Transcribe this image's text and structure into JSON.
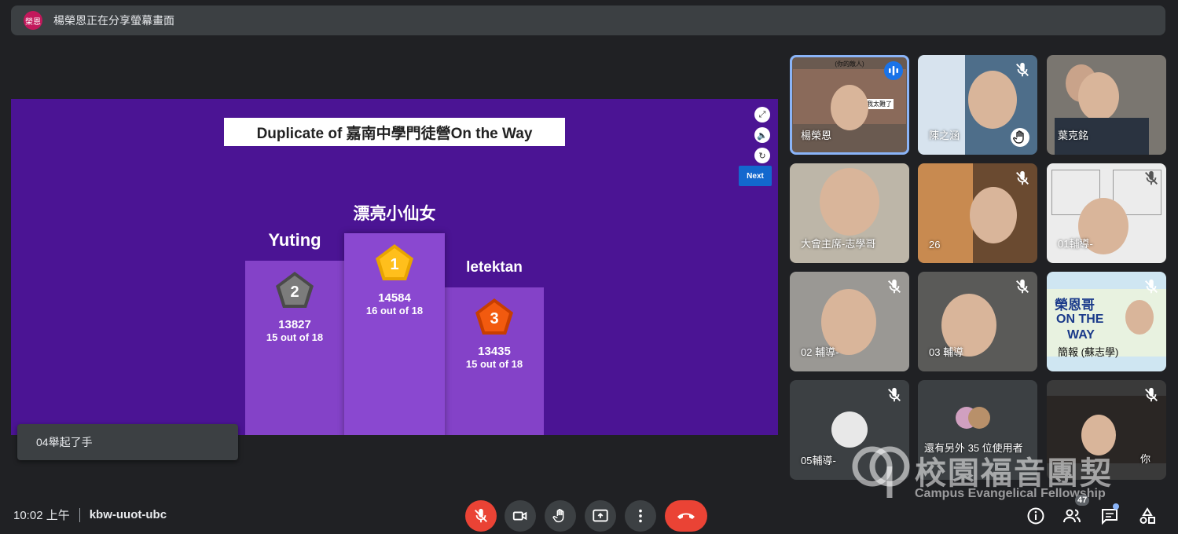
{
  "banner": {
    "avatar_text": "榮恩",
    "text": "楊榮恩正在分享螢幕畫面"
  },
  "slide": {
    "title": "Duplicate of 嘉南中學門徒營On the Way",
    "next_label": "Next",
    "podium": {
      "first": {
        "rank": "1",
        "name": "漂亮小仙女",
        "score": "14584",
        "detail": "16 out of 18"
      },
      "second": {
        "rank": "2",
        "name": "Yuting",
        "score": "13827",
        "detail": "15 out of 18"
      },
      "third": {
        "rank": "3",
        "name": "letektan",
        "score": "13435",
        "detail": "15 out of 18"
      }
    }
  },
  "toast": {
    "text": "04舉起了手"
  },
  "participants": [
    {
      "name": "楊榮恩",
      "overlay_top": "(你的敵人)",
      "overlay_mid": "我太難了"
    },
    {
      "name": "陳之涵"
    },
    {
      "name": "葉克銘"
    },
    {
      "name": "大會主席-志學哥"
    },
    {
      "name": "26"
    },
    {
      "name": "01輔導-"
    },
    {
      "name": "02 輔導-"
    },
    {
      "name": "03 輔導"
    },
    {
      "name": "簡報 (蘇志學)",
      "overlay_line1": "榮恩哥",
      "overlay_line2": "ON THE",
      "overlay_line3": "WAY"
    },
    {
      "name": "05輔導-"
    },
    {
      "name": "還有另外 35 位使用者"
    },
    {
      "name": "你"
    }
  ],
  "bottom": {
    "time": "10:02 上午",
    "meeting_code": "kbw-uuot-ubc",
    "people_count": "47"
  },
  "watermark": {
    "chinese": "校園福音團契",
    "english": "Campus Evangelical Fellowship"
  },
  "colors": {
    "end_call": "#ea4335",
    "slide_bg": "#4b1494",
    "active_speaker": "#8ab4f8"
  }
}
